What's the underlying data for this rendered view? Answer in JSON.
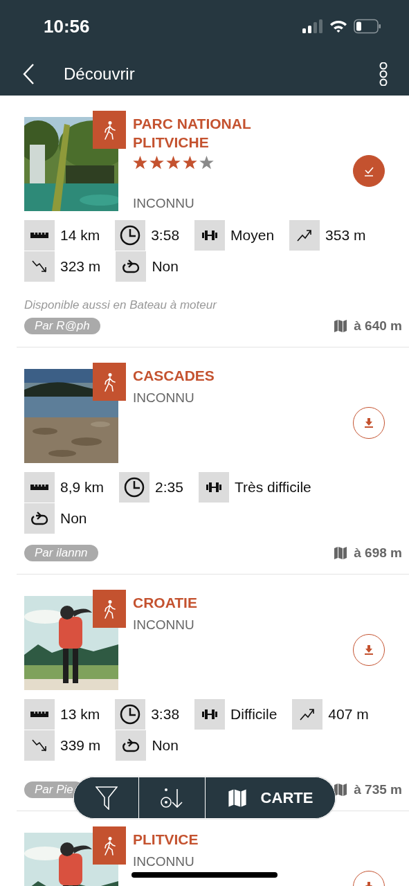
{
  "status_bar": {
    "time": "10:56"
  },
  "nav": {
    "title": "Découvrir"
  },
  "cards": [
    {
      "title": "PARC NATIONAL PLITVICHE",
      "stars": 4,
      "subtitle": "INCONNU",
      "downloaded": true,
      "stats": [
        {
          "kind": "distance",
          "value": "14 km"
        },
        {
          "kind": "duration",
          "value": "3:58"
        },
        {
          "kind": "difficulty",
          "value": "Moyen"
        },
        {
          "kind": "ascent",
          "value": "353 m"
        },
        {
          "kind": "descent",
          "value": "323 m"
        },
        {
          "kind": "loop",
          "value": "Non"
        }
      ],
      "note": "Disponible aussi en Bateau à moteur",
      "author": "Par R@ph",
      "distance": "à 640 m"
    },
    {
      "title": "CASCADES",
      "subtitle": "INCONNU",
      "downloaded": false,
      "stats": [
        {
          "kind": "distance",
          "value": "8,9 km"
        },
        {
          "kind": "duration",
          "value": "2:35"
        },
        {
          "kind": "difficulty",
          "value": "Très difficile"
        },
        {
          "kind": "loop",
          "value": "Non"
        }
      ],
      "author": "Par ilannn",
      "distance": "à 698 m"
    },
    {
      "title": "CROATIE",
      "subtitle": "INCONNU",
      "downloaded": false,
      "stats": [
        {
          "kind": "distance",
          "value": "13 km"
        },
        {
          "kind": "duration",
          "value": "3:38"
        },
        {
          "kind": "difficulty",
          "value": "Difficile"
        },
        {
          "kind": "ascent",
          "value": "407 m"
        },
        {
          "kind": "descent",
          "value": "339 m"
        },
        {
          "kind": "loop",
          "value": "Non"
        }
      ],
      "author": "Par Pie",
      "distance": "à 735 m"
    },
    {
      "title": "PLITVICE",
      "subtitle": "INCONNU",
      "downloaded": false
    }
  ],
  "bottom_bar": {
    "map_label": "CARTE"
  }
}
